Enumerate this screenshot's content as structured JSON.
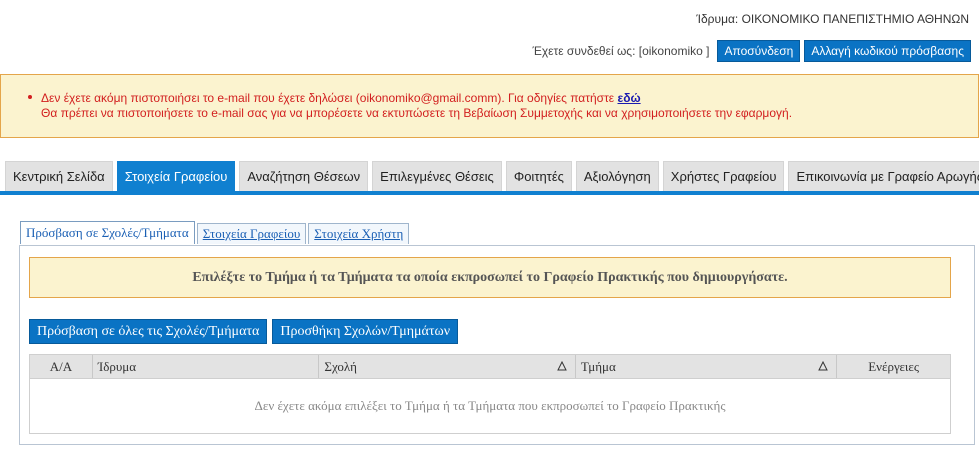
{
  "header": {
    "institution_label": "Ίδρυμα: ΟΙΚΟΝΟΜΙΚΟ ΠΑΝΕΠΙΣΤΗΜΙΟ ΑΘΗΝΩΝ",
    "logged_in_as": "Έχετε συνδεθεί ως: [oikonomiko  ]",
    "logout_label": "Αποσύνδεση",
    "change_password_label": "Αλλαγή κωδικού πρόσβασης"
  },
  "alert": {
    "line1_text": "Δεν έχετε ακόμη πιστοποιήσει το e-mail που έχετε δηλώσει (oikonomiko@gmail.comm). Για οδηγίες πατήστε ",
    "line1_link": "εδώ",
    "line2_text": "Θα πρέπει να πιστοποιήσετε το e-mail σας για να μπορέσετε να εκτυπώσετε τη Βεβαίωση Συμμετοχής και να χρησιμοποιήσετε την εφαρμογή."
  },
  "nav": {
    "tabs": [
      {
        "label": "Κεντρική Σελίδα"
      },
      {
        "label": "Στοιχεία Γραφείου"
      },
      {
        "label": "Αναζήτηση Θέσεων"
      },
      {
        "label": "Επιλεγμένες Θέσεις"
      },
      {
        "label": "Φοιτητές"
      },
      {
        "label": "Αξιολόγηση"
      },
      {
        "label": "Χρήστες Γραφείου"
      },
      {
        "label": "Επικοινωνία με Γραφείο Αρωγής"
      }
    ],
    "active_index": 1
  },
  "subtabs": [
    {
      "label": "Πρόσβαση σε Σχολές/Τμήματα"
    },
    {
      "label": "Στοιχεία Γραφείου"
    },
    {
      "label": "Στοιχεία Χρήστη"
    }
  ],
  "panel": {
    "info_message": "Επιλέξτε το Τμήμα ή τα Τμήματα τα οποία εκπροσωπεί το Γραφείο Πρακτικής που δημιουργήσατε.",
    "access_all_label": "Πρόσβαση σε όλες τις Σχολές/Τμήματα",
    "add_label": "Προσθήκη Σχολών/Τμημάτων",
    "table": {
      "columns": [
        "Α/Α",
        "Ίδρυμα",
        "Σχολή",
        "Τμήμα",
        "Ενέργειες"
      ],
      "empty_message": "Δεν έχετε ακόμα επιλέξει το Τμήμα ή τα Τμήματα που εκπροσωπεί το Γραφείο Πρακτικής"
    }
  }
}
